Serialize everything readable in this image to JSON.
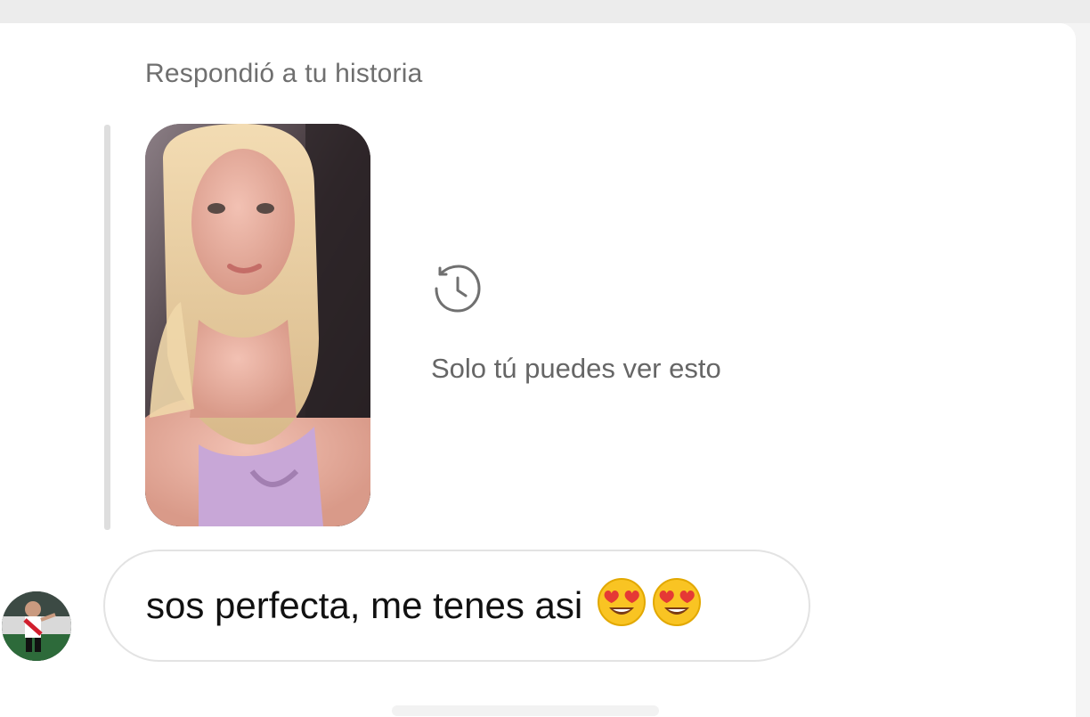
{
  "reply_context": {
    "header": "Respondió a tu historia",
    "private_note": "Solo tú puedes ver esto",
    "icon": "history-icon"
  },
  "story": {
    "thumbnail": "story-photo"
  },
  "message": {
    "text": "sos perfecta, me tenes asi",
    "emojis": [
      "heart-eyes-emoji",
      "heart-eyes-emoji"
    ]
  },
  "sender": {
    "avatar": "avatar"
  },
  "colors": {
    "secondary_text": "#6f6f6f",
    "bubble_border": "#e3e3e3",
    "message_text": "#111111"
  }
}
